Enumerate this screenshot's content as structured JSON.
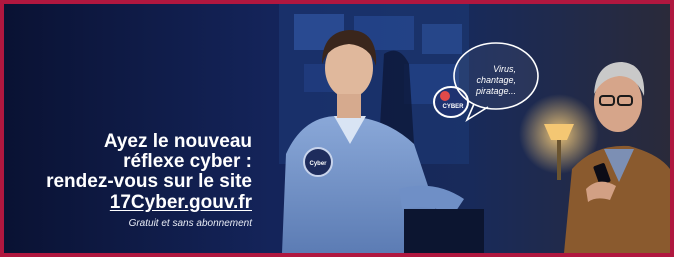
{
  "ad": {
    "headline_lines": [
      "Ayez le nouveau",
      "réflexe cyber :",
      "rendez-vous sur le site"
    ],
    "url": "17Cyber.gouv.fr",
    "subtext": "Gratuit et sans abonnement",
    "bubble_text": [
      "Virus,",
      "chantage,",
      "piratage..."
    ],
    "badge_text": "CYBER",
    "patch_text": "Cyber",
    "colors": {
      "border": "#b0173f",
      "background": "#0d1840",
      "text": "#ffffff"
    }
  }
}
